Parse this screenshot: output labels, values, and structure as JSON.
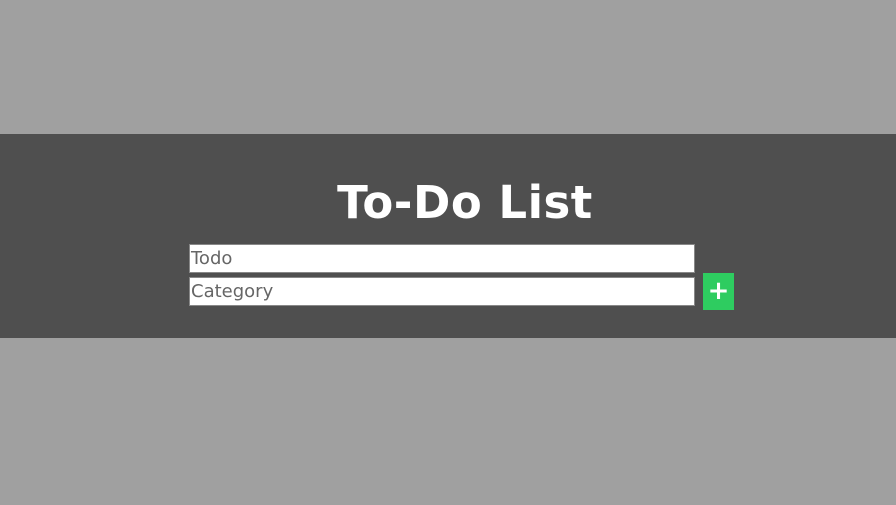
{
  "header": {
    "title": "To-Do List"
  },
  "form": {
    "todo_placeholder": "Todo",
    "category_placeholder": "Category",
    "add_label": "+"
  },
  "colors": {
    "accent": "#2ecc60",
    "band": "#4f4f4f",
    "background": "#a0a0a0"
  }
}
